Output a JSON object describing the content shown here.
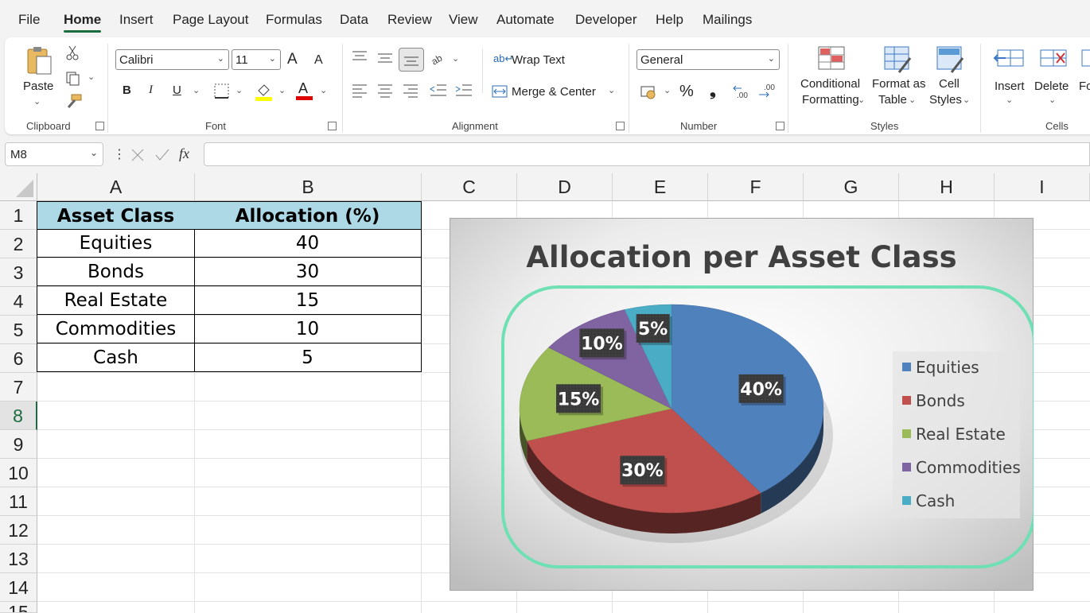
{
  "menu": {
    "items": [
      "File",
      "Home",
      "Insert",
      "Page Layout",
      "Formulas",
      "Data",
      "Review",
      "View",
      "Automate",
      "Developer",
      "Help",
      "Mailings"
    ],
    "active": "Home"
  },
  "ribbon": {
    "clipboard": {
      "paste": "Paste",
      "label": "Clipboard"
    },
    "font": {
      "name": "Calibri",
      "size": "11",
      "bold": "B",
      "italic": "I",
      "underline": "U",
      "grow": "A",
      "shrink": "A",
      "color": "A",
      "label": "Font"
    },
    "alignment": {
      "wrap": "Wrap Text",
      "merge": "Merge & Center",
      "label": "Alignment"
    },
    "number": {
      "format": "General",
      "percent": "%",
      "comma": "❟",
      "label": "Number"
    },
    "styles": {
      "conditional_1": "Conditional",
      "conditional_2": "Formatting",
      "format_table_1": "Format as",
      "format_table_2": "Table",
      "cell_styles_1": "Cell",
      "cell_styles_2": "Styles",
      "label": "Styles"
    },
    "cells": {
      "insert": "Insert",
      "delete": "Delete",
      "format": "Fo",
      "label": "Cells"
    }
  },
  "formula_bar": {
    "name_box": "M8",
    "fx": "fx",
    "content": ""
  },
  "sheet": {
    "columns": [
      "A",
      "B",
      "C",
      "D",
      "E",
      "F",
      "G",
      "H",
      "I"
    ],
    "rows": [
      "1",
      "2",
      "3",
      "4",
      "5",
      "6",
      "7",
      "8",
      "9",
      "10",
      "11",
      "12",
      "13",
      "14",
      "15"
    ],
    "selected_row": "8",
    "table": {
      "headers": [
        "Asset Class",
        "Allocation (%)"
      ],
      "rows": [
        [
          "Equities",
          "40"
        ],
        [
          "Bonds",
          "30"
        ],
        [
          "Real Estate",
          "15"
        ],
        [
          "Commodities",
          "10"
        ],
        [
          "Cash",
          "5"
        ]
      ]
    }
  },
  "chart_data": {
    "type": "pie",
    "title": "Allocation per Asset Class",
    "categories": [
      "Equities",
      "Bonds",
      "Real Estate",
      "Commodities",
      "Cash"
    ],
    "values": [
      40,
      30,
      15,
      10,
      5
    ],
    "data_labels": [
      "40%",
      "30%",
      "15%",
      "10%",
      "5%"
    ],
    "colors": [
      "#4f81bd",
      "#c0504d",
      "#9bbb59",
      "#8064a2",
      "#4bacc6"
    ],
    "legend_position": "right",
    "style": "3d",
    "highlight_color": "#6fe0b4"
  }
}
